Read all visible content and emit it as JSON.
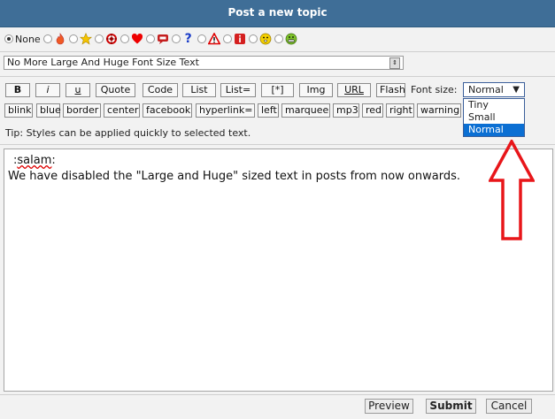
{
  "header": {
    "title": "Post a new topic"
  },
  "post_icons": {
    "none_label": "None",
    "selected": "None",
    "icons": [
      "flame-icon",
      "star-icon",
      "target-icon",
      "heart-icon",
      "speech-bubble-icon",
      "question-mark-icon",
      "warning-triangle-icon",
      "info-icon",
      "smiley-icon",
      "grin-icon"
    ]
  },
  "subject": {
    "value": "No More Large And Huge Font Size Text"
  },
  "toolbar": {
    "row1": [
      "B",
      "i",
      "u",
      "Quote",
      "Code",
      "List",
      "List=",
      "[*]",
      "Img",
      "URL",
      "Flash"
    ],
    "row2": [
      "blink",
      "blue",
      "border",
      "center",
      "facebook",
      "hyperlink=",
      "left",
      "marquee",
      "mp3",
      "red",
      "right",
      "warning"
    ],
    "font_size_label": "Font size:",
    "font_size_selected": "Normal",
    "font_size_options": [
      "Tiny",
      "Small",
      "Normal"
    ]
  },
  "tip": "Tip: Styles can be applied quickly to selected text.",
  "editor": {
    "line1_prefix": ":",
    "line1_word": "salam",
    "line1_suffix": ":",
    "line2": "We have disabled the \"Large and Huge\" sized text in posts from now onwards."
  },
  "actions": {
    "preview": "Preview",
    "submit": "Submit",
    "cancel": "Cancel"
  },
  "colors": {
    "header_bg": "#3f6e97",
    "selection": "#0b6fd3",
    "arrow": "#e8161a"
  }
}
